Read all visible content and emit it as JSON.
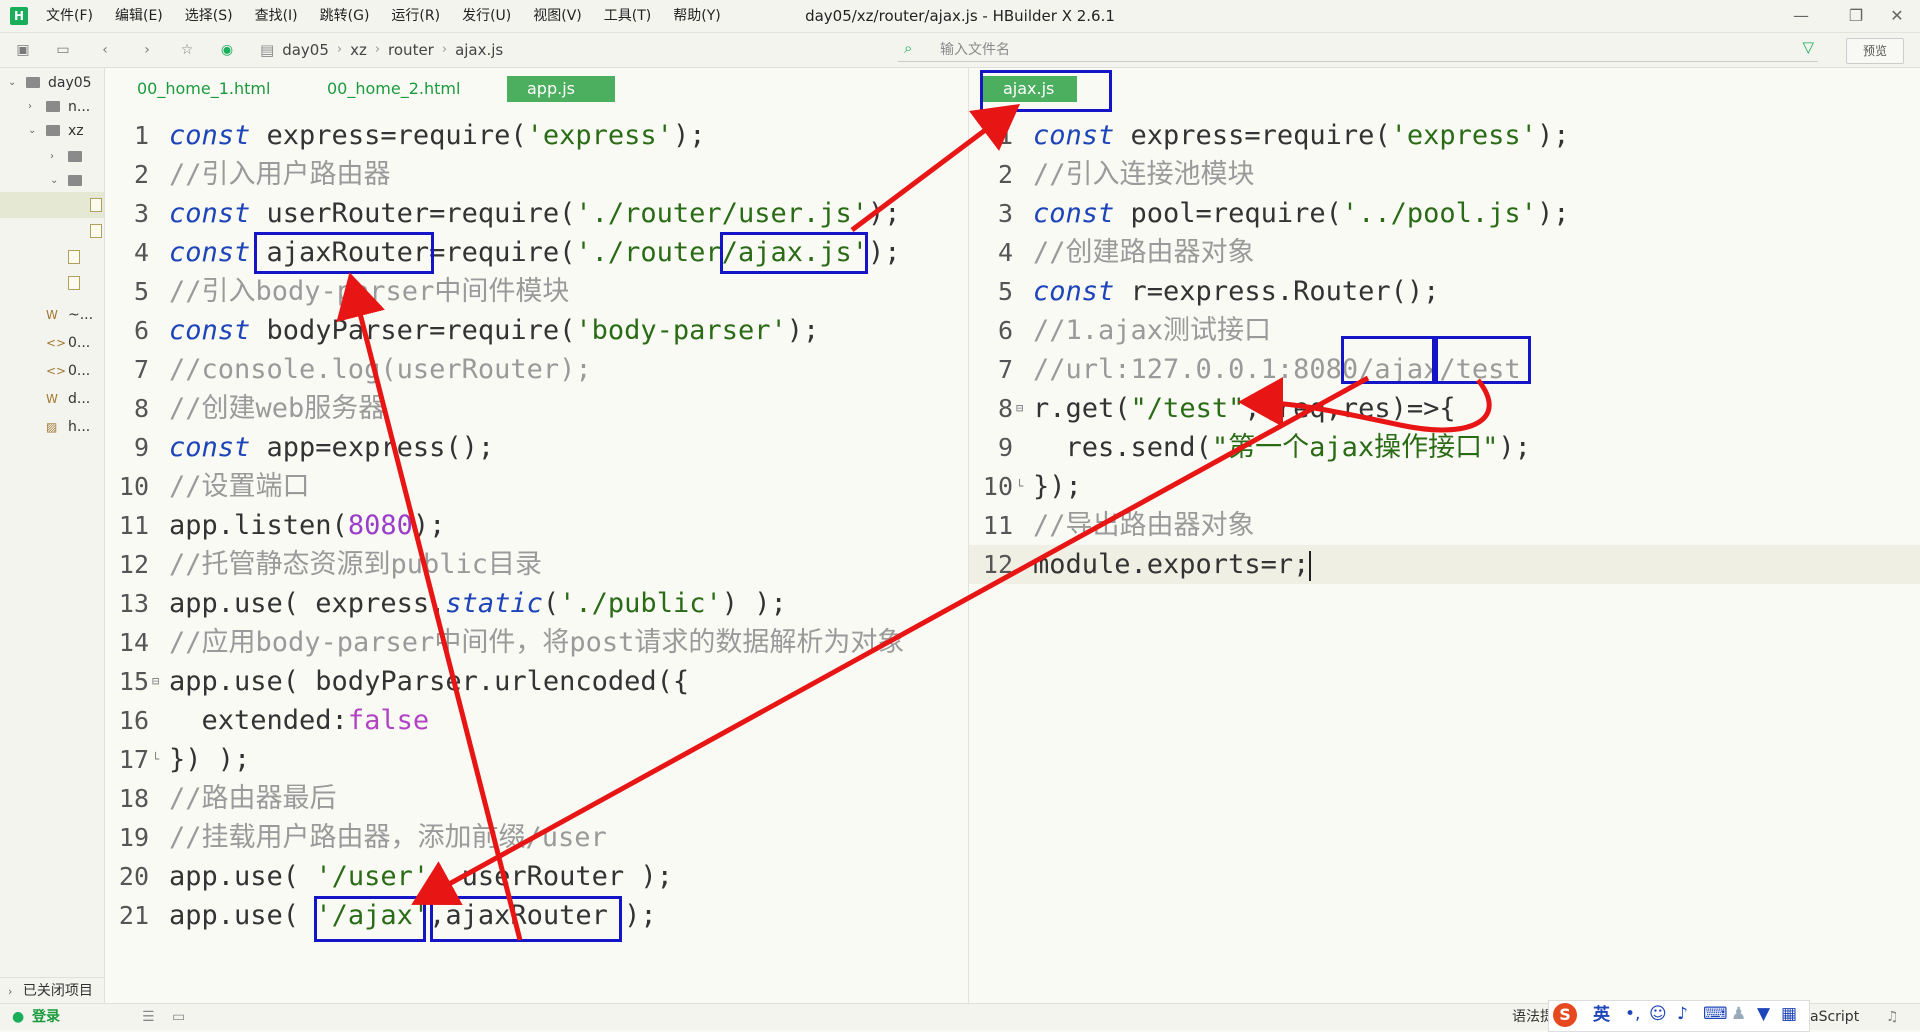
{
  "app": {
    "logo": "H",
    "title": "day05/xz/router/ajax.js - HBuilder X 2.6.1",
    "menus": [
      "文件(F)",
      "编辑(E)",
      "选择(S)",
      "查找(I)",
      "跳转(G)",
      "运行(R)",
      "发行(U)",
      "视图(V)",
      "工具(T)",
      "帮助(Y)"
    ],
    "window_controls": [
      "—",
      "❐",
      "✕"
    ]
  },
  "toolbar": {
    "breadcrumb": [
      "day05",
      "xz",
      "router",
      "ajax.js"
    ],
    "search_placeholder": "输入文件名",
    "preview_label": "预览"
  },
  "sidebar": {
    "items": [
      {
        "label": "day05",
        "arrow": "⌄",
        "icon": "folder"
      },
      {
        "label": "n...",
        "arrow": "›",
        "icon": "folder"
      },
      {
        "label": "xz",
        "arrow": "⌄",
        "icon": "folder"
      },
      {
        "label": "",
        "arrow": "›",
        "icon": "folder"
      },
      {
        "label": "",
        "arrow": "⌄",
        "icon": "folder"
      },
      {
        "label": "",
        "arrow": "",
        "icon": "file",
        "selected": true
      },
      {
        "label": "",
        "arrow": "",
        "icon": "file"
      },
      {
        "label": "",
        "arrow": "",
        "icon": "file"
      },
      {
        "label": "",
        "arrow": "",
        "icon": "file"
      },
      {
        "label": "~...",
        "arrow": "",
        "icon": "W"
      },
      {
        "label": "0...",
        "arrow": "",
        "icon": "<>"
      },
      {
        "label": "0...",
        "arrow": "",
        "icon": "<>"
      },
      {
        "label": "d...",
        "arrow": "",
        "icon": "W"
      },
      {
        "label": "h...",
        "arrow": "",
        "icon": "img"
      }
    ],
    "closed_projects": "已关闭项目"
  },
  "left_editor": {
    "tabs": [
      "00_home_1.html",
      "00_home_2.html",
      "app.js"
    ],
    "active_tab": 2,
    "lines": [
      "<span class=\"kw\">const</span> express=require(<span class=\"str\">'express'</span>);",
      "<span class=\"cmt\">//引入用户路由器</span>",
      "<span class=\"kw\">const</span> userRouter=require(<span class=\"str\">'./router/user.js'</span>);",
      "<span class=\"kw\">const</span> ajaxRouter=require(<span class=\"str\">'./router/ajax.js'</span>);",
      "<span class=\"cmt\">//引入body-parser中间件模块</span>",
      "<span class=\"kw\">const</span> bodyParser=require(<span class=\"str\">'body-parser'</span>);",
      "<span class=\"cmt\">//console.log(userRouter);</span>",
      "<span class=\"cmt\">//创建web服务器</span>",
      "<span class=\"kw\">const</span> app=express();",
      "<span class=\"cmt\">//设置端口</span>",
      "app.listen(<span class=\"num\">8080</span>);",
      "<span class=\"cmt\">//托管静态资源到public目录</span>",
      "app.use( express.<span class=\"kw\">static</span>(<span class=\"str\">'./public'</span>) );",
      "<span class=\"cmt\">//应用body-parser中间件，将post请求的数据解析为对象</span>",
      "app.use( bodyParser.urlencoded({",
      "  extended:<span class=\"bool\">false</span>",
      "}) );",
      "<span class=\"cmt\">//路由器最后</span>",
      "<span class=\"cmt\">//挂载用户路由器，添加前缀/user</span>",
      "app.use( <span class=\"str\">'/user'</span>, userRouter );",
      "app.use( <span class=\"str\">'/ajax'</span>,ajaxRouter );"
    ],
    "folds": {
      "15": "⊟",
      "17": "└"
    }
  },
  "right_editor": {
    "tabs": [
      "ajax.js"
    ],
    "active_tab": 0,
    "lines": [
      "<span class=\"kw\">const</span> express=require(<span class=\"str\">'express'</span>);",
      "<span class=\"cmt\">//引入连接池模块</span>",
      "<span class=\"kw\">const</span> pool=require(<span class=\"str\">'../pool.js'</span>);",
      "<span class=\"cmt\">//创建路由器对象</span>",
      "<span class=\"kw\">const</span> r=express.Router();",
      "<span class=\"cmt\">//1.ajax测试接口</span>",
      "<span class=\"cmt\">//url:127.0.0.1:8080/ajax/test</span>",
      "r.get(<span class=\"str\">\"/test\"</span>,(req,res)=>{",
      "  res.send(<span class=\"str\">\"第一个ajax操作接口\"</span>);",
      "});",
      "<span class=\"cmt\">//导出路由器对象</span>",
      "module.exports=r;<span class=\"cursor\"></span>"
    ],
    "folds": {
      "8": "⊟",
      "10": "└"
    },
    "highlight_line": 12
  },
  "statusbar": {
    "login": "登录",
    "syntax_hint": "语法提",
    "language": "aScript",
    "ime_label": "英"
  },
  "colors": {
    "accent_green": "#4cae5f",
    "annotation_box": "#1515c8",
    "annotation_arrow": "#e81515"
  }
}
